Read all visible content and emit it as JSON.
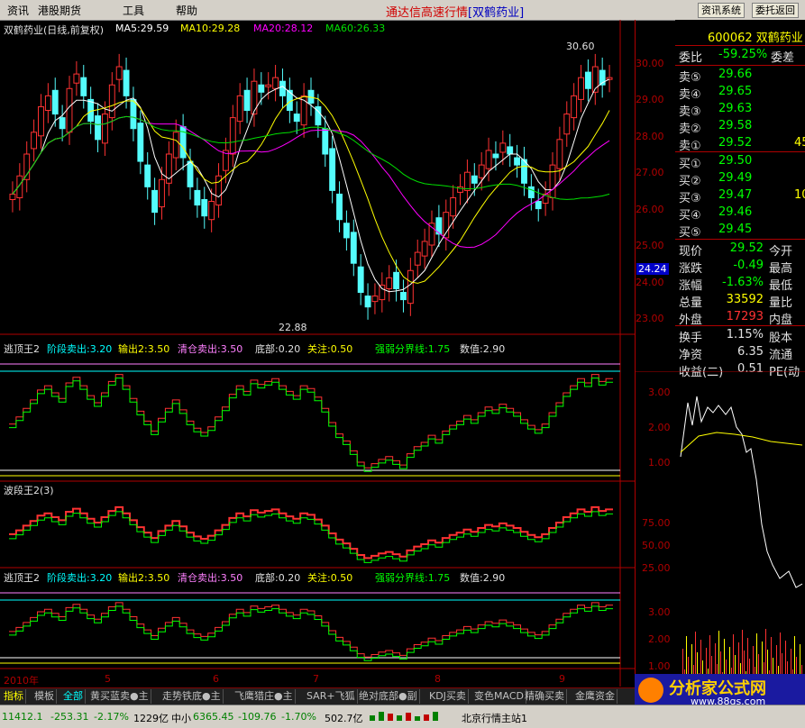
{
  "menu": {
    "items": [
      "资讯",
      "港股期货",
      "工具",
      "帮助"
    ],
    "app_title": "通达信高速行情",
    "stock_tag": "[双鹤药业]",
    "btn_info": "资讯系统",
    "btn_back": "委托返回"
  },
  "main": {
    "chart_header": {
      "name": "双鹤药业(日线,前复权)",
      "ma5": "MA5:29.59",
      "ma10": "MA10:29.28",
      "ma20": "MA20:28.12",
      "ma60": "MA60:26.33"
    },
    "high_label": "30.60",
    "low_label": "22.88",
    "price_scale": [
      "30.00",
      "29.00",
      "28.00",
      "27.00",
      "26.00",
      "25.00",
      "24.00",
      "23.00"
    ],
    "cross_price": "24.24",
    "panel1": {
      "name": "逃顶王2",
      "items": [
        "阶段卖出:3.20",
        "输出2:3.50",
        "清仓卖出:3.50",
        "底部:0.20",
        "关注:0.50",
        "强弱分界线:1.75",
        "数值:2.90"
      ],
      "scale": [
        "3.00",
        "2.00",
        "1.00"
      ]
    },
    "panel2": {
      "name": "波段王2(3)",
      "scale": [
        "75.00",
        "50.00",
        "25.00"
      ]
    },
    "panel3": {
      "name": "逃顶王2",
      "items": [
        "阶段卖出:3.20",
        "输出2:3.50",
        "清仓卖出:3.50",
        "底部:0.20",
        "关注:0.50",
        "强弱分界线:1.75",
        "数值:2.90"
      ],
      "scale": [
        "3.00",
        "2.00",
        "1.00"
      ]
    },
    "x_axis": [
      "2010年",
      "5",
      "6",
      "7",
      "8",
      "9"
    ]
  },
  "quote": {
    "code": "600062",
    "name": "双鹤药业",
    "wb_label": "委比",
    "wb_value": "-59.25%",
    "wc_label": "委差",
    "asks": [
      {
        "label": "卖⑤",
        "price": "29.66"
      },
      {
        "label": "卖④",
        "price": "29.65"
      },
      {
        "label": "卖③",
        "price": "29.63"
      },
      {
        "label": "卖②",
        "price": "29.58"
      },
      {
        "label": "卖①",
        "price": "29.52",
        "vol": "45"
      }
    ],
    "bids": [
      {
        "label": "买①",
        "price": "29.50"
      },
      {
        "label": "买②",
        "price": "29.49"
      },
      {
        "label": "买③",
        "price": "29.47",
        "vol": "10"
      },
      {
        "label": "买④",
        "price": "29.46"
      },
      {
        "label": "买⑤",
        "price": "29.45"
      }
    ],
    "stats": [
      {
        "label": "现价",
        "value": "29.52",
        "label2": "今开"
      },
      {
        "label": "涨跌",
        "value": "-0.49",
        "label2": "最高"
      },
      {
        "label": "涨幅",
        "value": "-1.63%",
        "label2": "最低"
      },
      {
        "label": "总量",
        "value": "33592",
        "label2": "量比"
      },
      {
        "label": "外盘",
        "value": "17293",
        "label2": "内盘"
      }
    ],
    "stats2": [
      {
        "label": "换手",
        "value": "1.15%",
        "label2": "股本"
      },
      {
        "label": "净资",
        "value": "6.35",
        "label2": "流通"
      },
      {
        "label": "收益(二)",
        "value": "0.51",
        "label2": "PE(动"
      }
    ]
  },
  "tabs": [
    "指标",
    "模板",
    "全部",
    "黄买蓝卖●主",
    "走势铁底●主",
    "飞鹰猎庄●主",
    "SAR+飞狐",
    "绝对底部●副",
    "KDJ买卖",
    "变色MACD",
    "精确买卖",
    "金鹰资金"
  ],
  "status": {
    "sh": "11412.1",
    "sh_chg": "-253.31",
    "sh_pct": "-2.17%",
    "sh_amt": "1229亿",
    "zx_label": "中小",
    "zx": "6365.45",
    "zx_chg": "-109.76",
    "zx_pct": "-1.70%",
    "zx_amt": "502.7亿",
    "server": "北京行情主站1"
  },
  "watermark": {
    "brand": "分析家公式网",
    "url": "www.88gs.com"
  },
  "colors": {
    "up": "#ff3232",
    "down": "#54fcfc",
    "ma5": "#ffffff",
    "ma10": "#ffff00",
    "ma20": "#ff00ff",
    "ma60": "#00e000",
    "green": "#00ff00",
    "bg": "#000000"
  }
}
